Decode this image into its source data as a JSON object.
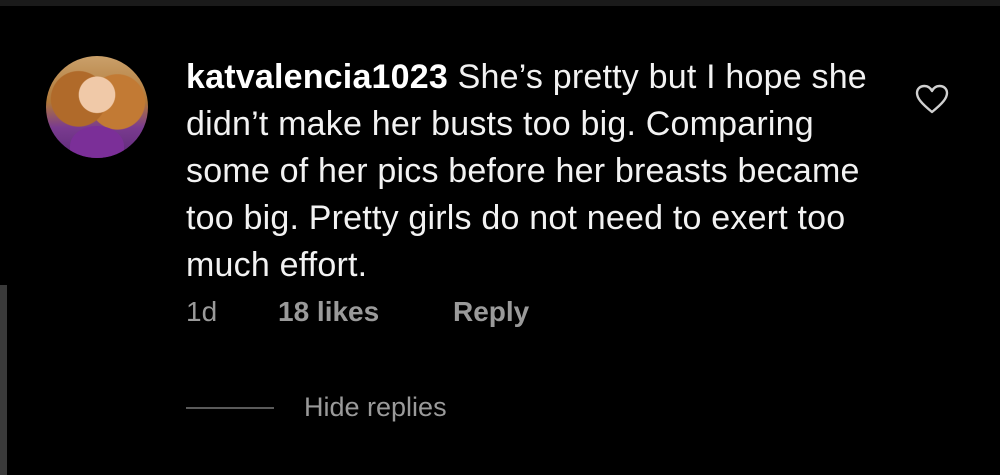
{
  "comment": {
    "username": "katvalencia1023",
    "text": "She’s pretty but I hope she didn’t make her busts too big. Comparing some of her pics before her breasts became too big. Pretty girls do not need to exert too much effort.",
    "time": "1d",
    "likes": "18 likes",
    "reply_label": "Reply",
    "hide_replies_label": "Hide replies"
  },
  "colors": {
    "background": "#000000",
    "text": "#f2f2f2",
    "muted": "#9a9a9a"
  }
}
